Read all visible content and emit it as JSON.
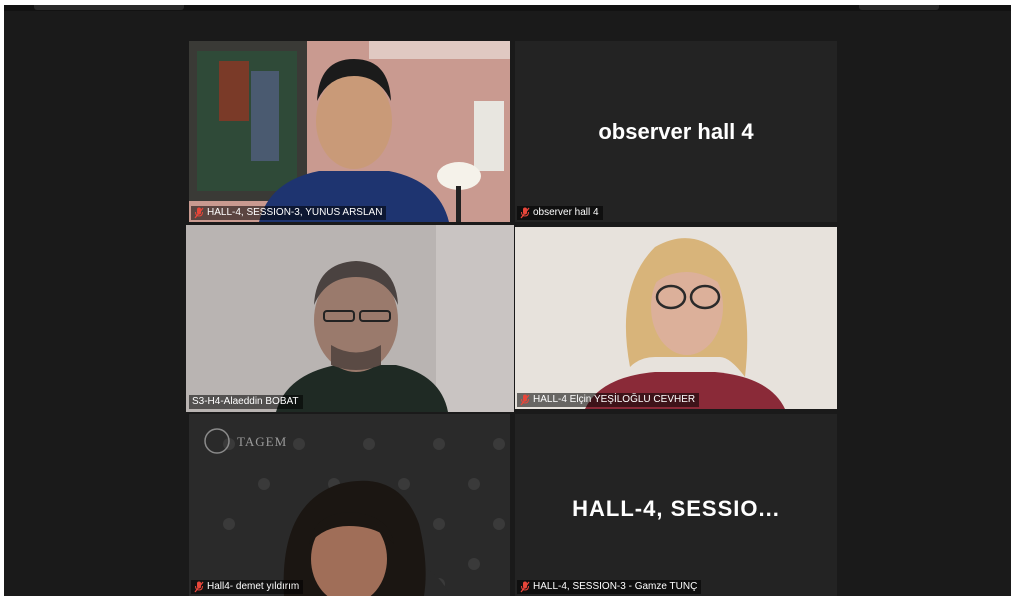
{
  "tiles": [
    {
      "tag": "HALL-4, SESSION-3, YUNUS ARSLAN",
      "muted": true
    },
    {
      "tag": "observer hall 4",
      "display_name": "observer hall 4",
      "muted": true
    },
    {
      "tag": "S3-H4-Alaeddin BOBAT",
      "muted": false,
      "active": true
    },
    {
      "tag": "HALL-4 Elçin YEŞİLOĞLU CEVHER",
      "muted": true
    },
    {
      "tag": "Hall4- demet yıldırım",
      "muted": true,
      "bg_logo": "TAGEM"
    },
    {
      "tag": "HALL-4, SESSION-3 - Gamze TUNÇ",
      "display_name": "HALL-4,  SESSIO...",
      "muted": true
    }
  ],
  "colors": {
    "active_border": "#c8e06a",
    "mic_muted": "#e8463a",
    "background": "#1a1a1a"
  }
}
